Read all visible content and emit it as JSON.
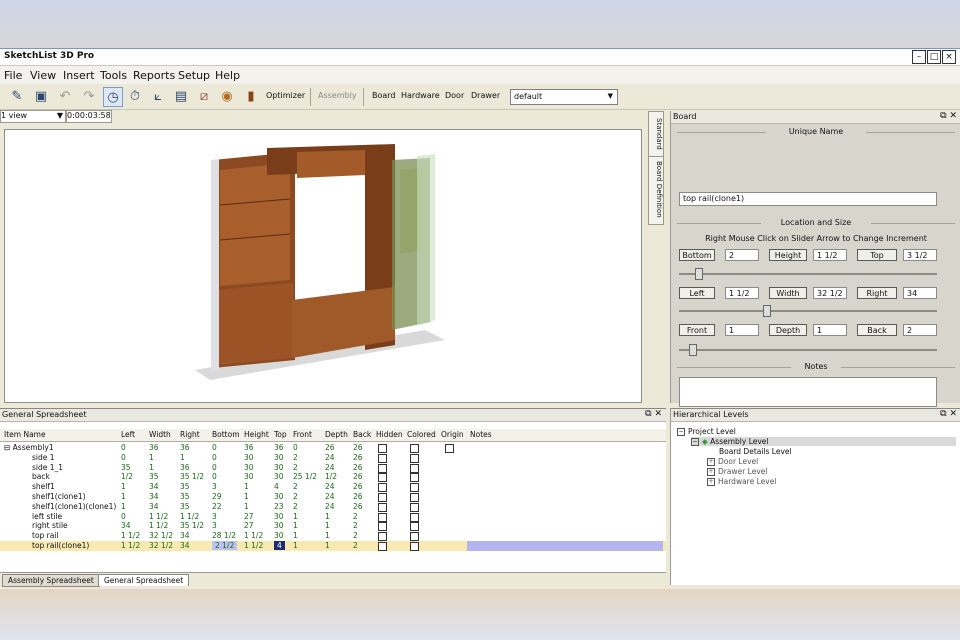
{
  "window": {
    "title": "SketchList 3D Pro"
  },
  "menu": [
    "File",
    "View",
    "Insert",
    "Tools",
    "Reports",
    "Setup",
    "Help"
  ],
  "toolbar": {
    "optimizer": "Optimizer",
    "assembly": "Assembly",
    "board": "Board",
    "hardware": "Hardware",
    "door": "Door",
    "drawer": "Drawer",
    "style_value": "default"
  },
  "viewbar": {
    "view_select": "1 view",
    "time": "0:00:03:58"
  },
  "side_tabs": [
    "Standard",
    "Board Definition"
  ],
  "board_panel": {
    "title": "Board",
    "unique_name_label": "Unique Name",
    "unique_name_value": "top rail(clone1)",
    "location_label": "Location and Size",
    "hint": "Right Mouse Click on Slider Arrow to Change Increment",
    "bottom_label": "Bottom",
    "bottom_value": "2",
    "height_label": "Height",
    "height_value": "1 1/2",
    "top_label": "Top",
    "top_value": "3 1/2",
    "left_label": "Left",
    "left_value": "1 1/2",
    "width_label": "Width",
    "width_value": "32 1/2",
    "right_label": "Right",
    "right_value": "34",
    "front_label": "Front",
    "front_value": "1",
    "depth_label": "Depth",
    "depth_value": "1",
    "back_label": "Back",
    "back_value": "2",
    "notes_label": "Notes"
  },
  "spreadsheet": {
    "title": "General Spreadsheet",
    "columns": [
      "Item Name",
      "Left",
      "Width",
      "Right",
      "Bottom",
      "Height",
      "Top",
      "Front",
      "Depth",
      "Back",
      "Hidden",
      "Colored",
      "Origin",
      "Notes"
    ],
    "rows": [
      {
        "name": "Assembly1",
        "left": "0",
        "width": "36",
        "right": "36",
        "bottom": "0",
        "height": "36",
        "top": "36",
        "front": "0",
        "depth": "26",
        "back": "26"
      },
      {
        "name": "side 1",
        "left": "0",
        "width": "1",
        "right": "1",
        "bottom": "0",
        "height": "30",
        "top": "30",
        "front": "2",
        "depth": "24",
        "back": "26"
      },
      {
        "name": "side 1_1",
        "left": "35",
        "width": "1",
        "right": "36",
        "bottom": "0",
        "height": "30",
        "top": "30",
        "front": "2",
        "depth": "24",
        "back": "26"
      },
      {
        "name": "back",
        "left": "1/2",
        "width": "35",
        "right": "35 1/2",
        "bottom": "0",
        "height": "30",
        "top": "30",
        "front": "25 1/2",
        "depth": "1/2",
        "back": "26"
      },
      {
        "name": "shelf1",
        "left": "1",
        "width": "34",
        "right": "35",
        "bottom": "3",
        "height": "1",
        "top": "4",
        "front": "2",
        "depth": "24",
        "back": "26"
      },
      {
        "name": "shelf1(clone1)",
        "left": "1",
        "width": "34",
        "right": "35",
        "bottom": "29",
        "height": "1",
        "top": "30",
        "front": "2",
        "depth": "24",
        "back": "26"
      },
      {
        "name": "shelf1(clone1)(clone1)",
        "left": "1",
        "width": "34",
        "right": "35",
        "bottom": "22",
        "height": "1",
        "top": "23",
        "front": "2",
        "depth": "24",
        "back": "26"
      },
      {
        "name": "left stile",
        "left": "0",
        "width": "1 1/2",
        "right": "1 1/2",
        "bottom": "3",
        "height": "27",
        "top": "30",
        "front": "1",
        "depth": "1",
        "back": "2"
      },
      {
        "name": "right stile",
        "left": "34",
        "width": "1 1/2",
        "right": "35 1/2",
        "bottom": "3",
        "height": "27",
        "top": "30",
        "front": "1",
        "depth": "1",
        "back": "2"
      },
      {
        "name": "top rail",
        "left": "1 1/2",
        "width": "32 1/2",
        "right": "34",
        "bottom": "28 1/2",
        "height": "1 1/2",
        "top": "30",
        "front": "1",
        "depth": "1",
        "back": "2"
      },
      {
        "name": "top rail(clone1)",
        "left": "1 1/2",
        "width": "32 1/2",
        "right": "34",
        "bottom": "2 1/2",
        "height": "1 1/2",
        "top": "4",
        "front": "1",
        "depth": "1",
        "back": "2"
      }
    ],
    "tabs": [
      "Assembly Spreadsheet",
      "General Spreadsheet"
    ]
  },
  "hierarchy": {
    "title": "Hierarchical Levels",
    "nodes": [
      "Project Level",
      "Assembly Level",
      "Board Details Level",
      "Door Level",
      "Drawer Level",
      "Hardware Level"
    ]
  }
}
